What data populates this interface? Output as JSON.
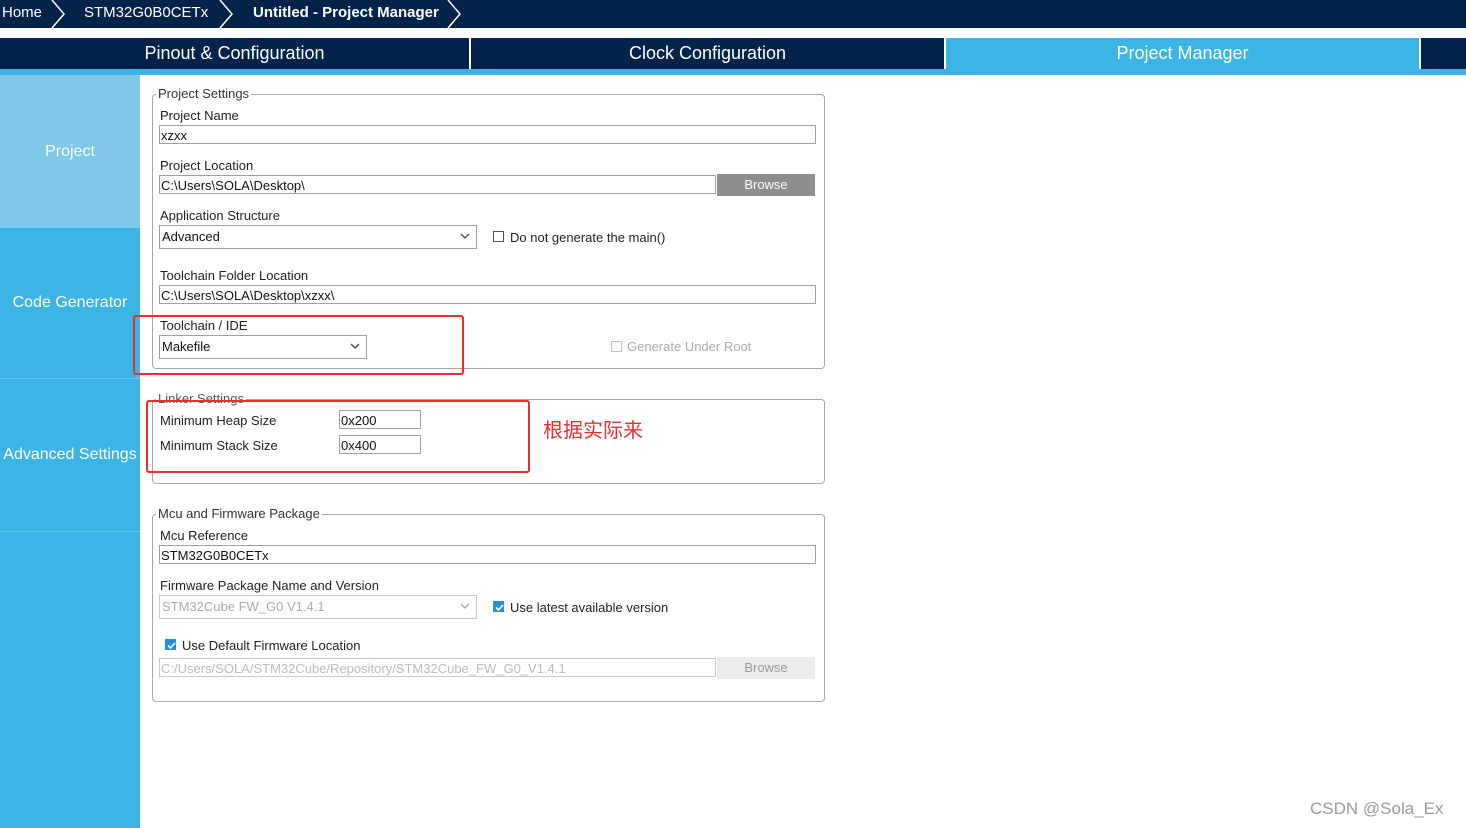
{
  "breadcrumb": {
    "items": [
      "Home",
      "STM32G0B0CETx",
      "Untitled - Project Manager"
    ]
  },
  "tabs": [
    {
      "label": "Pinout & Configuration"
    },
    {
      "label": "Clock Configuration"
    },
    {
      "label": "Project Manager"
    }
  ],
  "sidebar": {
    "items": [
      {
        "label": "Project"
      },
      {
        "label": "Code Generator"
      },
      {
        "label": "Advanced Settings"
      }
    ]
  },
  "project_settings": {
    "legend": "Project Settings",
    "name_label": "Project Name",
    "name_value": "xzxx",
    "location_label": "Project Location",
    "location_value": "C:\\Users\\SOLA\\Desktop\\",
    "browse_label": "Browse",
    "app_structure_label": "Application Structure",
    "app_structure_value": "Advanced",
    "no_main_label": "Do not generate the main()",
    "toolchain_folder_label": "Toolchain Folder Location",
    "toolchain_folder_value": "C:\\Users\\SOLA\\Desktop\\xzxx\\",
    "toolchain_ide_label": "Toolchain / IDE",
    "toolchain_ide_value": "Makefile",
    "generate_under_root_label": "Generate Under Root"
  },
  "linker_settings": {
    "legend": "Linker Settings",
    "heap_label": "Minimum Heap Size",
    "heap_value": "0x200",
    "stack_label": "Minimum Stack Size",
    "stack_value": "0x400"
  },
  "annotation": "根据实际来",
  "mcu": {
    "legend": "Mcu and Firmware Package",
    "ref_label": "Mcu Reference",
    "ref_value": "STM32G0B0CETx",
    "fw_label": "Firmware Package Name and Version",
    "fw_value": "STM32Cube FW_G0 V1.4.1",
    "use_latest_label": "Use latest available version",
    "use_default_label": "Use Default Firmware Location",
    "fw_location_value": "C:/Users/SOLA/STM32Cube/Repository/STM32Cube_FW_G0_V1.4.1",
    "browse_label": "Browse"
  },
  "watermark": "CSDN @Sola_Ex",
  "colors": {
    "navy": "#03234b",
    "accent": "#3cb4e6",
    "highlight": "#e53030"
  }
}
